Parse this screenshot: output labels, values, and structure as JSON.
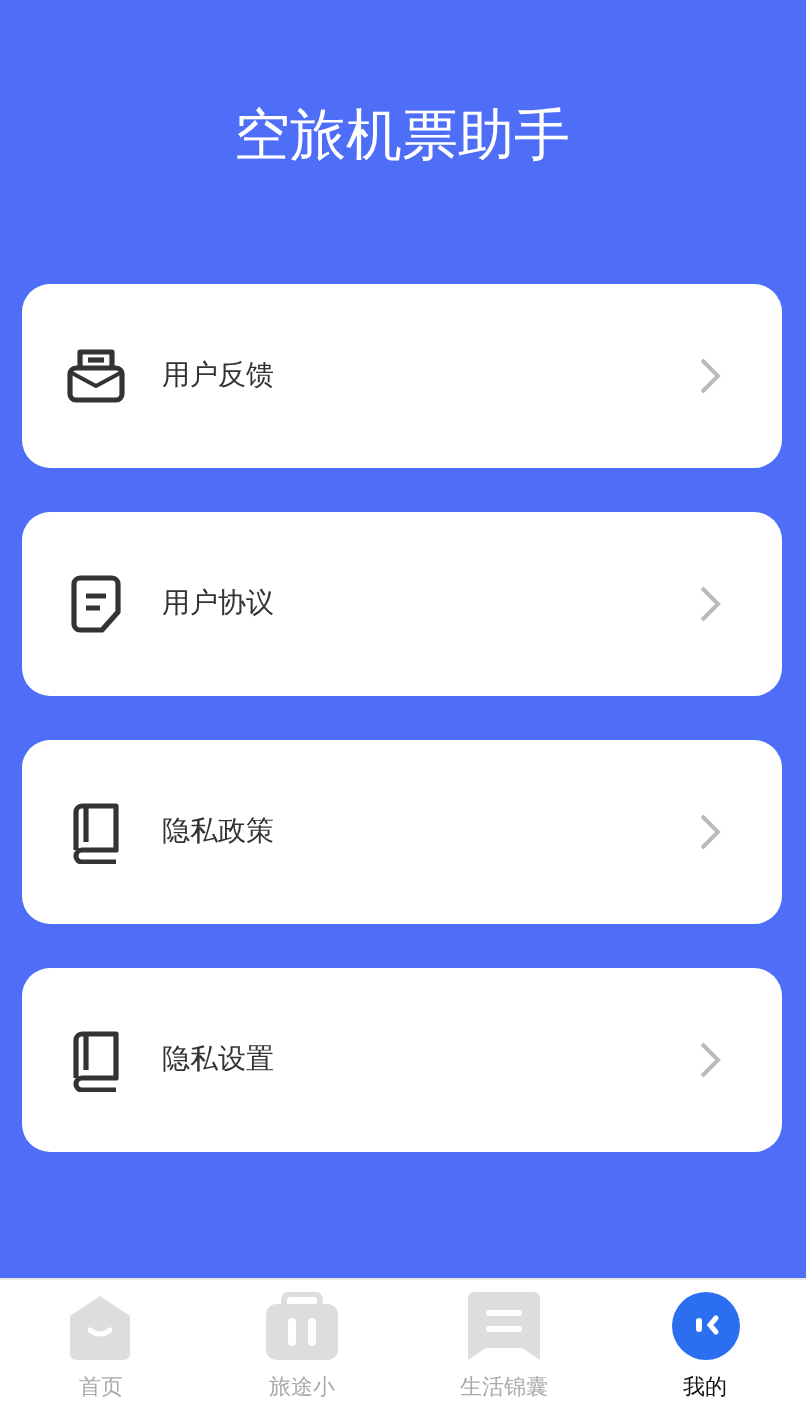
{
  "title": "空旅机票助手",
  "items": [
    {
      "kind": "inbox",
      "label": "用户反馈"
    },
    {
      "kind": "note",
      "label": "用户协议"
    },
    {
      "kind": "book",
      "label": "隐私政策"
    },
    {
      "kind": "book",
      "label": "隐私设置"
    }
  ],
  "tabs": [
    {
      "kind": "home",
      "label": "首页",
      "selected": false
    },
    {
      "kind": "luggage",
      "label": "旅途小",
      "selected": false
    },
    {
      "kind": "bookmark",
      "label": "生活锦囊",
      "selected": false
    },
    {
      "kind": "face",
      "label": "我的",
      "selected": true
    }
  ]
}
